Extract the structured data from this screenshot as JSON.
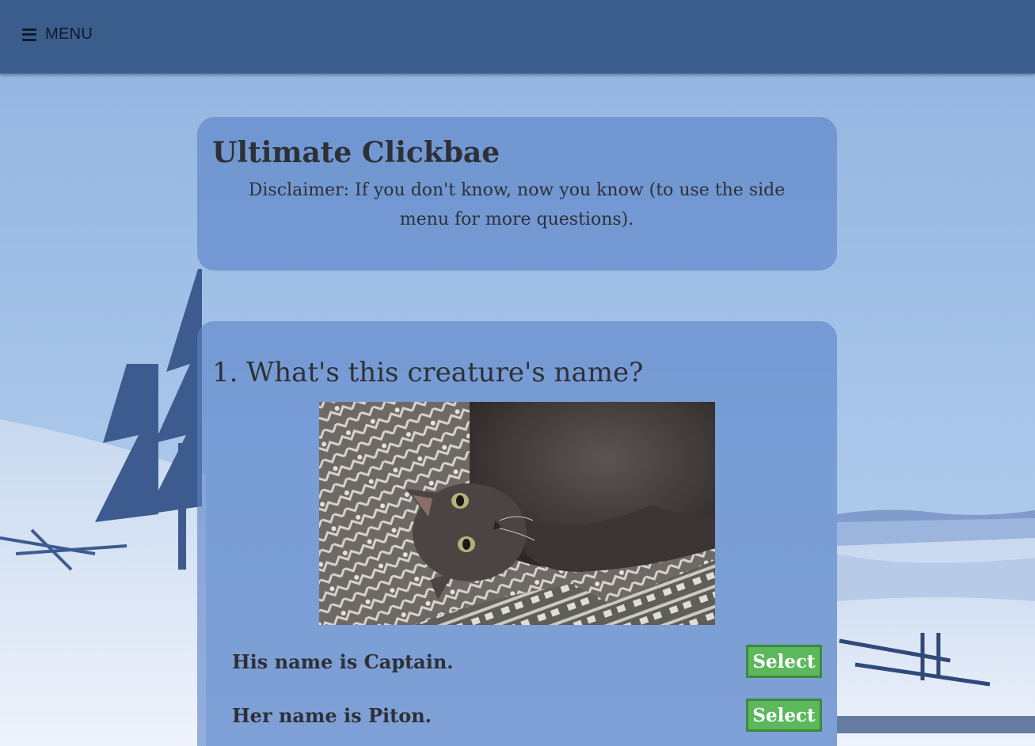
{
  "nav": {
    "menu_label": "MENU",
    "menu_icon": "hamburger-icon"
  },
  "header": {
    "title": "Ultimate Clickbae",
    "disclaimer": "Disclaimer: If you don't know, now you know (to use the side menu for more questions)."
  },
  "question": {
    "title": "1. What's this creature's name?",
    "answers": [
      {
        "text": "His name is Captain.",
        "button": "Select"
      },
      {
        "text": "Her name is Piton.",
        "button": "Select"
      }
    ]
  },
  "colors": {
    "topbar": "#3b5d8c",
    "card": "#5a82c8",
    "select_button": "#5cb85c",
    "text": "#2e3036"
  }
}
